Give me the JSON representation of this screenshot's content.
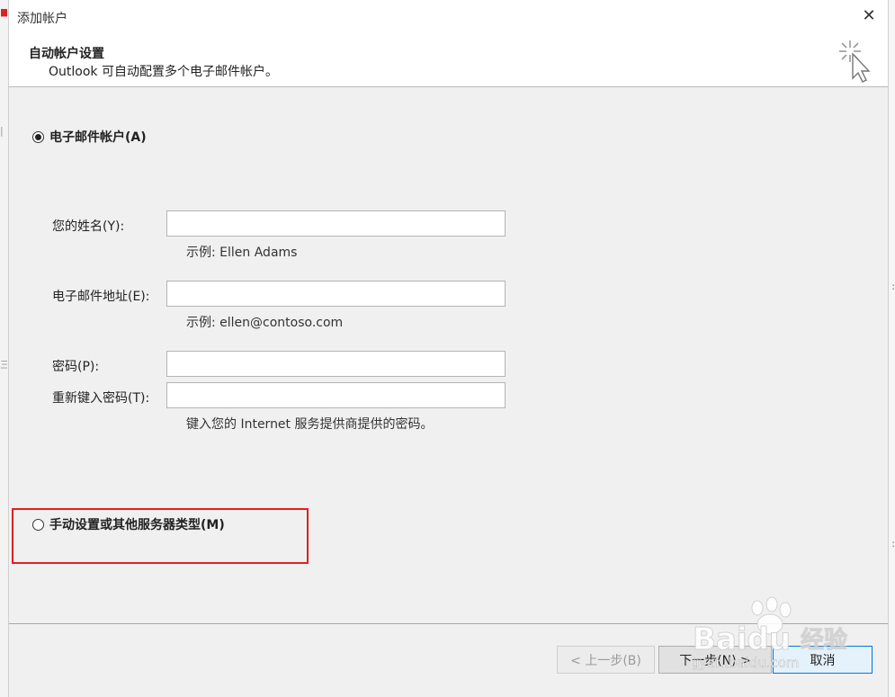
{
  "window": {
    "title": "添加帐户"
  },
  "header": {
    "title": "自动帐户设置",
    "subtitle": "Outlook 可自动配置多个电子邮件帐户。"
  },
  "options": {
    "email_account": {
      "label": "电子邮件帐户(A)",
      "checked": true
    },
    "manual_setup": {
      "label": "手动设置或其他服务器类型(M)",
      "checked": false
    }
  },
  "form": {
    "name": {
      "label": "您的姓名(Y):",
      "value": "",
      "hint": "示例: Ellen Adams"
    },
    "email": {
      "label": "电子邮件地址(E):",
      "value": "",
      "hint": "示例: ellen@contoso.com"
    },
    "password": {
      "label": "密码(P):",
      "value": ""
    },
    "retype": {
      "label": "重新键入密码(T):",
      "value": "",
      "hint": "键入您的 Internet 服务提供商提供的密码。"
    }
  },
  "buttons": {
    "back": "< 上一步(B)",
    "next": "下一步(N) >",
    "cancel": "取消"
  },
  "watermark": {
    "brand": "Baidu",
    "brand_cn": "经验",
    "url": "jingyan.baidu.com"
  },
  "colors": {
    "highlight": "#e02020",
    "accent": "#0078d7"
  },
  "icons": {
    "header": "sparkle-cursor-icon",
    "close": "close-icon"
  }
}
